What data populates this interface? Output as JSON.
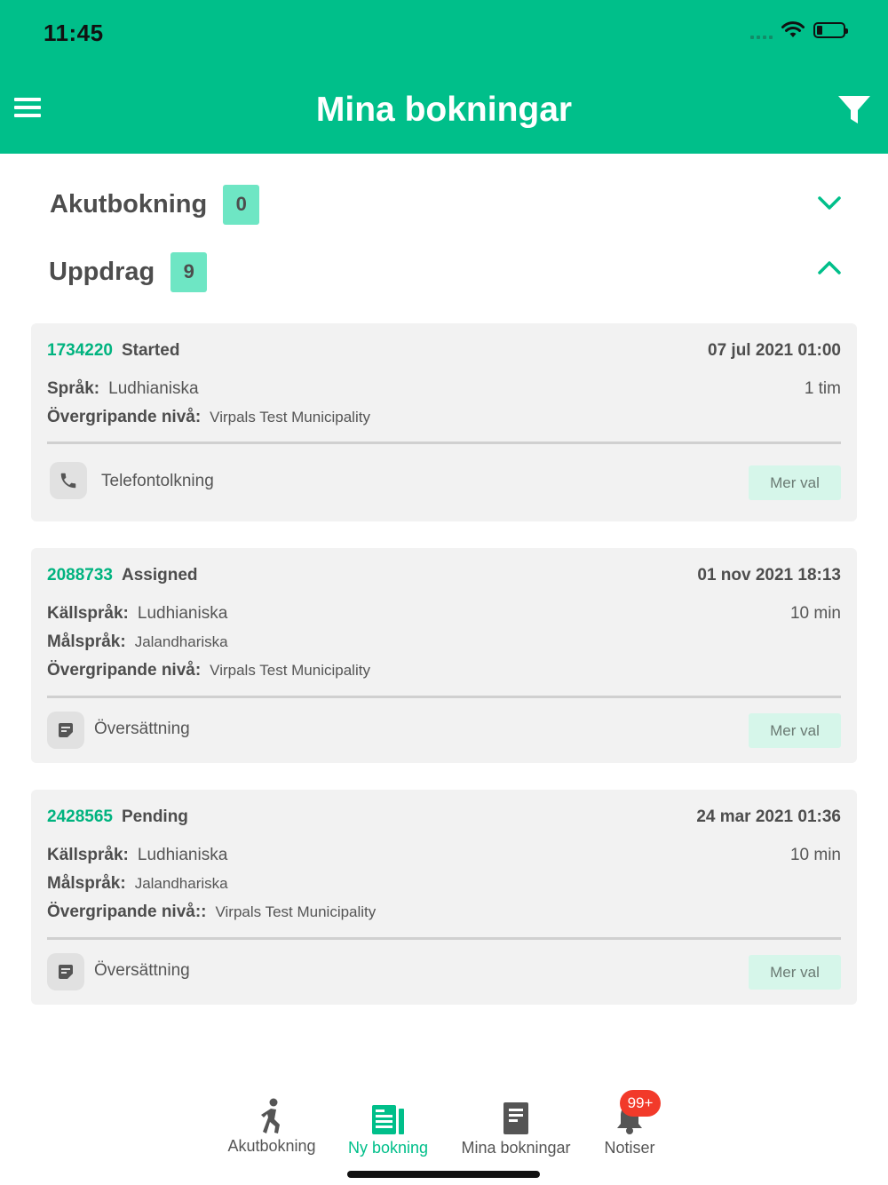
{
  "status_bar": {
    "time": "11:45"
  },
  "header": {
    "title": "Mina bokningar"
  },
  "sections": [
    {
      "label": "Akutbokning",
      "count": "0",
      "expanded": false
    },
    {
      "label": "Uppdrag",
      "count": "9",
      "expanded": true
    }
  ],
  "bookings": [
    {
      "id": "1734220",
      "status": "Started",
      "date": "07 jul 2021 01:00",
      "rows": [
        {
          "label": "Språk:",
          "value": "Ludhianiska",
          "right": "1 tim"
        },
        {
          "label": "Övergripande nivå:",
          "value": "Virpals Test Municipality",
          "right": ""
        }
      ],
      "service": "Telefontolkning",
      "service_icon": "phone-icon",
      "more_label": "Mer val"
    },
    {
      "id": "2088733",
      "status": "Assigned",
      "date": "01 nov 2021 18:13",
      "rows": [
        {
          "label": "Källspråk:",
          "value": "Ludhianiska",
          "right": "10 min"
        },
        {
          "label": "Målspråk:",
          "value": "Jalandhariska",
          "right": ""
        },
        {
          "label": "Övergripande nivå:",
          "value": "Virpals Test Municipality",
          "right": ""
        }
      ],
      "service": "Översättning",
      "service_icon": "document-edit-icon",
      "more_label": "Mer val"
    },
    {
      "id": "2428565",
      "status": "Pending",
      "date": "24 mar 2021 01:36",
      "rows": [
        {
          "label": "Källspråk:",
          "value": "Ludhianiska",
          "right": "10 min"
        },
        {
          "label": "Målspråk:",
          "value": "Jalandhariska",
          "right": ""
        },
        {
          "label": "Övergripande nivå::",
          "value": "Virpals Test Municipality",
          "right": ""
        }
      ],
      "service": "Översättning",
      "service_icon": "document-edit-icon",
      "more_label": "Mer val"
    }
  ],
  "tabbar": {
    "items": [
      {
        "label": "Akutbokning",
        "icon": "walking-person-icon",
        "active": false
      },
      {
        "label": "Ny bokning",
        "icon": "new-booking-icon",
        "active": true
      },
      {
        "label": "Mina bokningar",
        "icon": "document-icon",
        "active": false
      },
      {
        "label": "Notiser",
        "icon": "bell-icon",
        "active": false,
        "badge": "99+"
      }
    ]
  },
  "colors": {
    "brand": "#00bf8a",
    "badge": "#6ee6c4",
    "notification": "#f23a2a"
  }
}
